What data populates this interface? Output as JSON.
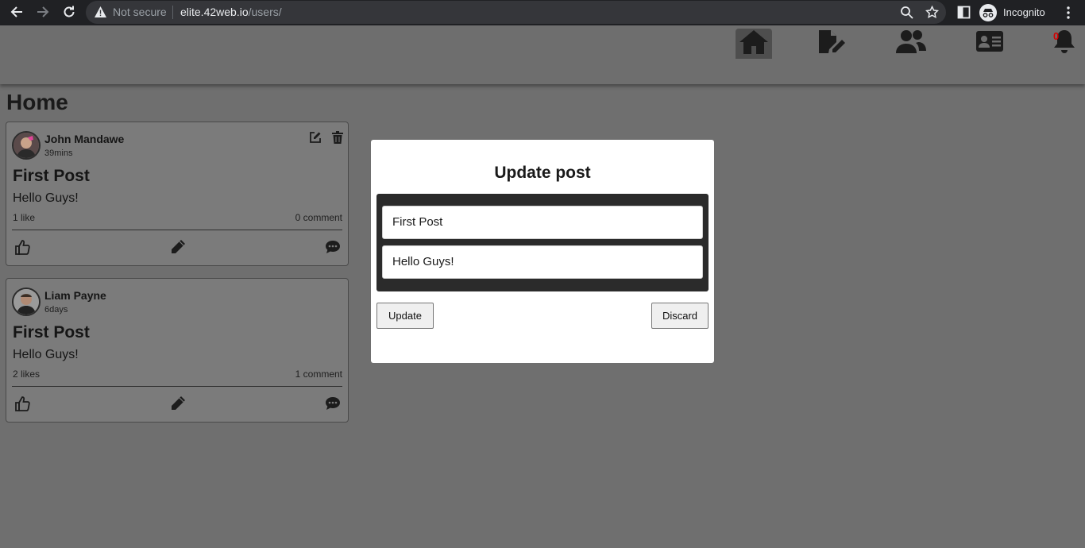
{
  "browser": {
    "security_label": "Not secure",
    "url_host": "elite.42web.io",
    "url_path": "/users/",
    "profile_label": "Incognito"
  },
  "nav": {
    "items": [
      "home-icon",
      "edit-post-icon",
      "users-icon",
      "profile-card-icon",
      "bell-icon"
    ],
    "notification_count": "0"
  },
  "page": {
    "title": "Home"
  },
  "posts": [
    {
      "author": "John Mandawe",
      "time": "39mins",
      "title": "First Post",
      "body": "Hello Guys!",
      "likes": "1 like",
      "comments": "0 comment",
      "owned": true
    },
    {
      "author": "Liam Payne",
      "time": "6days",
      "title": "First Post",
      "body": "Hello Guys!",
      "likes": "2 likes",
      "comments": "1 comment",
      "owned": false
    }
  ],
  "modal": {
    "title": "Update post",
    "title_value": "First Post",
    "body_value": "Hello Guys!",
    "update_label": "Update",
    "discard_label": "Discard"
  },
  "colors": {
    "overlay": "#6f6f6f",
    "chrome": "#202124",
    "notification": "#d50000"
  }
}
